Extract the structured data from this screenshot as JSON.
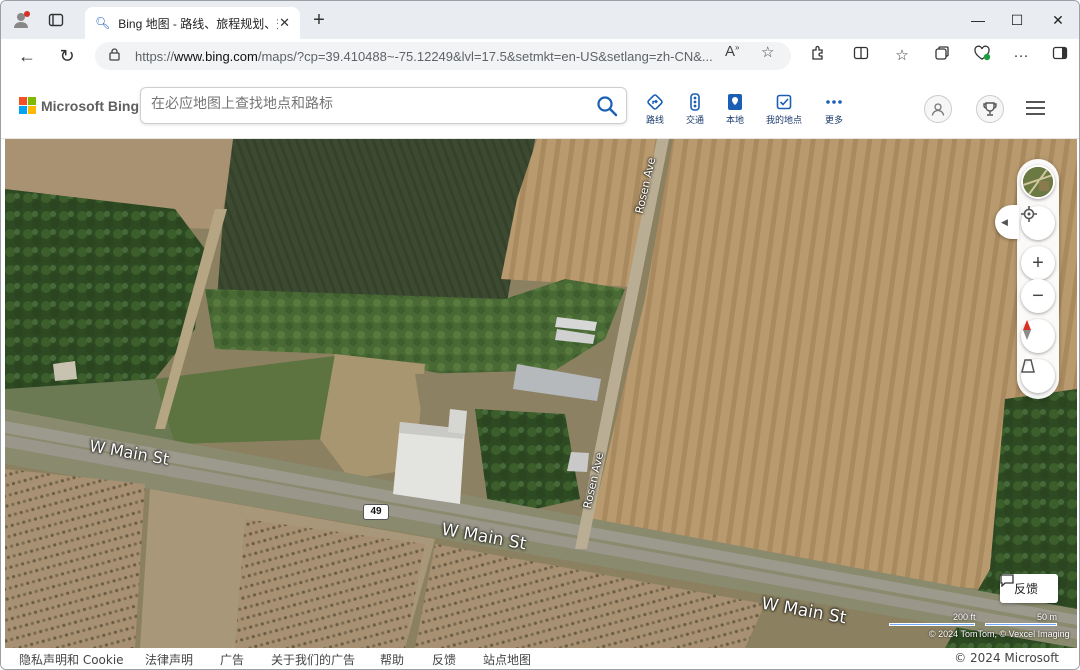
{
  "browser": {
    "tab_title": "Bing 地图 - 路线、旅程规划、交通",
    "url_prefix": "https://",
    "url_host": "www.bing.com",
    "url_rest": "/maps/?cp=39.410488~-75.12249&lvl=17.5&setmkt=en-US&setlang=zh-CN&..."
  },
  "bing": {
    "logo_text": "Microsoft Bing",
    "search_placeholder": "在必应地图上查找地点和路标",
    "nav": [
      {
        "label": "路线",
        "icon": "directions-icon"
      },
      {
        "label": "交通",
        "icon": "traffic-icon"
      },
      {
        "label": "本地",
        "icon": "local-icon"
      },
      {
        "label": "我的地点",
        "icon": "my-places-icon"
      },
      {
        "label": "更多",
        "icon": "more-icon"
      }
    ],
    "logo_colors": [
      "#f25022",
      "#7fba00",
      "#00a4ef",
      "#ffb900"
    ]
  },
  "map": {
    "labels": {
      "w_main_st_1": "W Main St",
      "w_main_st_2": "W Main St",
      "w_main_st_3": "W Main St",
      "rosen_ave_1": "Rosen Ave",
      "rosen_ave_2": "Rosen Ave"
    },
    "route_shield": "49",
    "feedback_label": "反馈",
    "scale_ft": "200 ft",
    "scale_m": "50 m",
    "imagery_credit": "© 2024 TomTom, © Vexcel Imaging"
  },
  "footer": {
    "links": [
      "隐私声明和 Cookie",
      "法律声明",
      "广告",
      "关于我们的广告",
      "帮助",
      "反馈",
      "站点地图"
    ],
    "copyright": "© 2024 Microsoft"
  }
}
